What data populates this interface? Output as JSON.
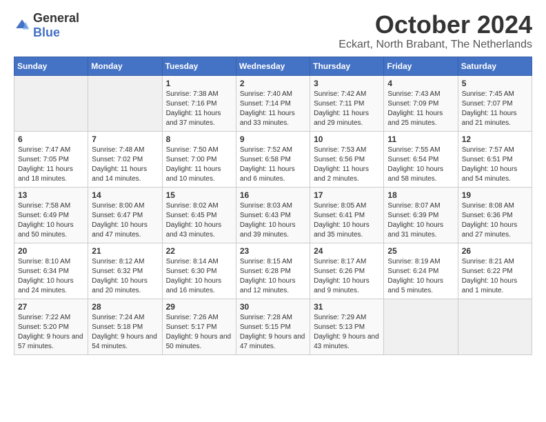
{
  "header": {
    "logo_general": "General",
    "logo_blue": "Blue",
    "month": "October 2024",
    "location": "Eckart, North Brabant, The Netherlands"
  },
  "weekdays": [
    "Sunday",
    "Monday",
    "Tuesday",
    "Wednesday",
    "Thursday",
    "Friday",
    "Saturday"
  ],
  "weeks": [
    [
      {
        "day": "",
        "info": ""
      },
      {
        "day": "",
        "info": ""
      },
      {
        "day": "1",
        "info": "Sunrise: 7:38 AM\nSunset: 7:16 PM\nDaylight: 11 hours and 37 minutes."
      },
      {
        "day": "2",
        "info": "Sunrise: 7:40 AM\nSunset: 7:14 PM\nDaylight: 11 hours and 33 minutes."
      },
      {
        "day": "3",
        "info": "Sunrise: 7:42 AM\nSunset: 7:11 PM\nDaylight: 11 hours and 29 minutes."
      },
      {
        "day": "4",
        "info": "Sunrise: 7:43 AM\nSunset: 7:09 PM\nDaylight: 11 hours and 25 minutes."
      },
      {
        "day": "5",
        "info": "Sunrise: 7:45 AM\nSunset: 7:07 PM\nDaylight: 11 hours and 21 minutes."
      }
    ],
    [
      {
        "day": "6",
        "info": "Sunrise: 7:47 AM\nSunset: 7:05 PM\nDaylight: 11 hours and 18 minutes."
      },
      {
        "day": "7",
        "info": "Sunrise: 7:48 AM\nSunset: 7:02 PM\nDaylight: 11 hours and 14 minutes."
      },
      {
        "day": "8",
        "info": "Sunrise: 7:50 AM\nSunset: 7:00 PM\nDaylight: 11 hours and 10 minutes."
      },
      {
        "day": "9",
        "info": "Sunrise: 7:52 AM\nSunset: 6:58 PM\nDaylight: 11 hours and 6 minutes."
      },
      {
        "day": "10",
        "info": "Sunrise: 7:53 AM\nSunset: 6:56 PM\nDaylight: 11 hours and 2 minutes."
      },
      {
        "day": "11",
        "info": "Sunrise: 7:55 AM\nSunset: 6:54 PM\nDaylight: 10 hours and 58 minutes."
      },
      {
        "day": "12",
        "info": "Sunrise: 7:57 AM\nSunset: 6:51 PM\nDaylight: 10 hours and 54 minutes."
      }
    ],
    [
      {
        "day": "13",
        "info": "Sunrise: 7:58 AM\nSunset: 6:49 PM\nDaylight: 10 hours and 50 minutes."
      },
      {
        "day": "14",
        "info": "Sunrise: 8:00 AM\nSunset: 6:47 PM\nDaylight: 10 hours and 47 minutes."
      },
      {
        "day": "15",
        "info": "Sunrise: 8:02 AM\nSunset: 6:45 PM\nDaylight: 10 hours and 43 minutes."
      },
      {
        "day": "16",
        "info": "Sunrise: 8:03 AM\nSunset: 6:43 PM\nDaylight: 10 hours and 39 minutes."
      },
      {
        "day": "17",
        "info": "Sunrise: 8:05 AM\nSunset: 6:41 PM\nDaylight: 10 hours and 35 minutes."
      },
      {
        "day": "18",
        "info": "Sunrise: 8:07 AM\nSunset: 6:39 PM\nDaylight: 10 hours and 31 minutes."
      },
      {
        "day": "19",
        "info": "Sunrise: 8:08 AM\nSunset: 6:36 PM\nDaylight: 10 hours and 27 minutes."
      }
    ],
    [
      {
        "day": "20",
        "info": "Sunrise: 8:10 AM\nSunset: 6:34 PM\nDaylight: 10 hours and 24 minutes."
      },
      {
        "day": "21",
        "info": "Sunrise: 8:12 AM\nSunset: 6:32 PM\nDaylight: 10 hours and 20 minutes."
      },
      {
        "day": "22",
        "info": "Sunrise: 8:14 AM\nSunset: 6:30 PM\nDaylight: 10 hours and 16 minutes."
      },
      {
        "day": "23",
        "info": "Sunrise: 8:15 AM\nSunset: 6:28 PM\nDaylight: 10 hours and 12 minutes."
      },
      {
        "day": "24",
        "info": "Sunrise: 8:17 AM\nSunset: 6:26 PM\nDaylight: 10 hours and 9 minutes."
      },
      {
        "day": "25",
        "info": "Sunrise: 8:19 AM\nSunset: 6:24 PM\nDaylight: 10 hours and 5 minutes."
      },
      {
        "day": "26",
        "info": "Sunrise: 8:21 AM\nSunset: 6:22 PM\nDaylight: 10 hours and 1 minute."
      }
    ],
    [
      {
        "day": "27",
        "info": "Sunrise: 7:22 AM\nSunset: 5:20 PM\nDaylight: 9 hours and 57 minutes."
      },
      {
        "day": "28",
        "info": "Sunrise: 7:24 AM\nSunset: 5:18 PM\nDaylight: 9 hours and 54 minutes."
      },
      {
        "day": "29",
        "info": "Sunrise: 7:26 AM\nSunset: 5:17 PM\nDaylight: 9 hours and 50 minutes."
      },
      {
        "day": "30",
        "info": "Sunrise: 7:28 AM\nSunset: 5:15 PM\nDaylight: 9 hours and 47 minutes."
      },
      {
        "day": "31",
        "info": "Sunrise: 7:29 AM\nSunset: 5:13 PM\nDaylight: 9 hours and 43 minutes."
      },
      {
        "day": "",
        "info": ""
      },
      {
        "day": "",
        "info": ""
      }
    ]
  ]
}
